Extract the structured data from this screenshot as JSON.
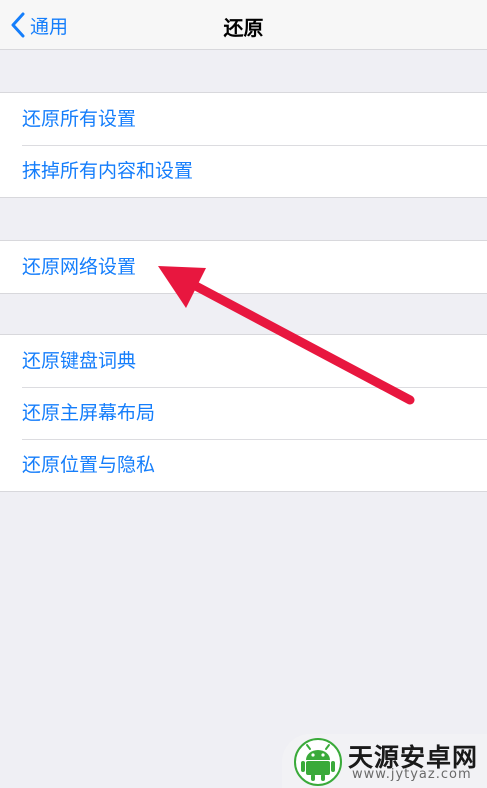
{
  "navbar": {
    "back_label": "通用",
    "title": "还原"
  },
  "groups": [
    {
      "items": [
        {
          "label": "还原所有设置"
        },
        {
          "label": "抹掉所有内容和设置"
        }
      ]
    },
    {
      "items": [
        {
          "label": "还原网络设置"
        }
      ]
    },
    {
      "items": [
        {
          "label": "还原键盘词典"
        },
        {
          "label": "还原主屏幕布局"
        },
        {
          "label": "还原位置与隐私"
        }
      ]
    }
  ],
  "annotation": {
    "arrow_color": "#e8173f",
    "target_item": "还原网络设置"
  },
  "watermark": {
    "name": "天源安卓网",
    "url": "www.jytyaz.com",
    "logo_icon": "android-robot-icon",
    "accent_color": "#3aaa3a"
  },
  "colors": {
    "accent": "#157efb",
    "background": "#efeff4"
  }
}
